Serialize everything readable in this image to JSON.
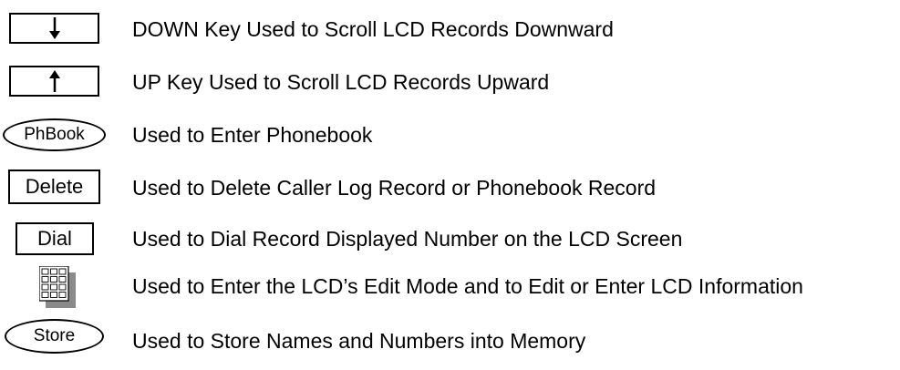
{
  "keys": [
    {
      "icon": "down-arrow-icon",
      "label": "",
      "description": "DOWN Key Used to Scroll LCD Records Downward"
    },
    {
      "icon": "up-arrow-icon",
      "label": "",
      "description": "UP Key Used to Scroll LCD Records Upward"
    },
    {
      "icon": "oval-key",
      "label": "PhBook",
      "description": "Used to Enter Phonebook"
    },
    {
      "icon": "rect-key",
      "label": "Delete",
      "description": "Used to Delete Caller Log Record or Phonebook Record"
    },
    {
      "icon": "rect-key",
      "label": "Dial",
      "description": "Used to Dial Record Displayed Number on the LCD Screen"
    },
    {
      "icon": "keypad-icon",
      "label": "",
      "description": "Used to Enter the LCD’s Edit Mode and to Edit or Enter LCD Information"
    },
    {
      "icon": "oval-key",
      "label": "Store",
      "description": "Used to Store Names and Numbers into Memory"
    }
  ],
  "colors": {
    "ink": "#000000",
    "keypad_shadow": "#8a8a8a",
    "background": "#ffffff"
  }
}
